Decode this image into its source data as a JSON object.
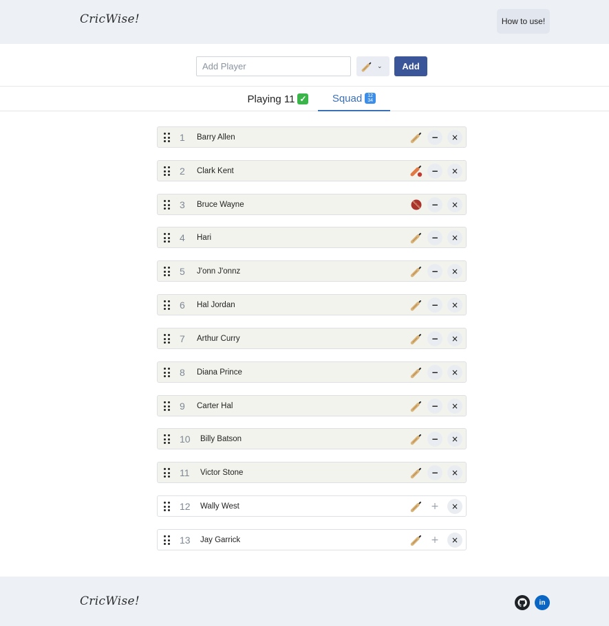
{
  "app": {
    "logo_text": "CricWise!"
  },
  "header": {
    "how_to_label": "How to use!"
  },
  "add_player": {
    "placeholder": "Add Player",
    "value": "",
    "selected_role": "bat-icon",
    "add_label": "Add"
  },
  "tabs": [
    {
      "label": "Playing 11",
      "emoji": "✓",
      "active": false
    },
    {
      "label": "Squad",
      "emoji": "1234",
      "active": true
    }
  ],
  "players": [
    {
      "index": "1",
      "name": "Barry Allen",
      "role": "bat-icon",
      "in_playing": true
    },
    {
      "index": "2",
      "name": "Clark Kent",
      "role": "bat-ball-icon",
      "in_playing": true
    },
    {
      "index": "3",
      "name": "Bruce Wayne",
      "role": "ball-icon",
      "in_playing": true
    },
    {
      "index": "4",
      "name": "Hari",
      "role": "bat-icon",
      "in_playing": true
    },
    {
      "index": "5",
      "name": "J'onn J'onnz",
      "role": "bat-icon",
      "in_playing": true
    },
    {
      "index": "6",
      "name": "Hal Jordan",
      "role": "bat-icon",
      "in_playing": true
    },
    {
      "index": "7",
      "name": "Arthur Curry",
      "role": "bat-icon",
      "in_playing": true
    },
    {
      "index": "8",
      "name": "Diana Prince",
      "role": "bat-icon",
      "in_playing": true
    },
    {
      "index": "9",
      "name": "Carter Hal",
      "role": "bat-icon",
      "in_playing": true
    },
    {
      "index": "10",
      "name": "Billy Batson",
      "role": "bat-icon",
      "in_playing": true
    },
    {
      "index": "11",
      "name": "Victor Stone",
      "role": "bat-icon",
      "in_playing": true
    },
    {
      "index": "12",
      "name": "Wally West",
      "role": "bat-icon",
      "in_playing": false
    },
    {
      "index": "13",
      "name": "Jay Garrick",
      "role": "bat-icon",
      "in_playing": false
    }
  ],
  "controls": {
    "remove_from_playing": "−",
    "add_to_playing": "+",
    "delete": "×"
  },
  "footer": {
    "logo_text": "CricWise!",
    "links": [
      {
        "icon": "github-icon"
      },
      {
        "icon": "linkedin-icon",
        "text": "in"
      }
    ]
  },
  "colors": {
    "primary": "#3a5598",
    "tab_active": "#3a6fb5",
    "header_bg": "#edf1f6",
    "playing_row_bg": "#f3f3ee"
  }
}
